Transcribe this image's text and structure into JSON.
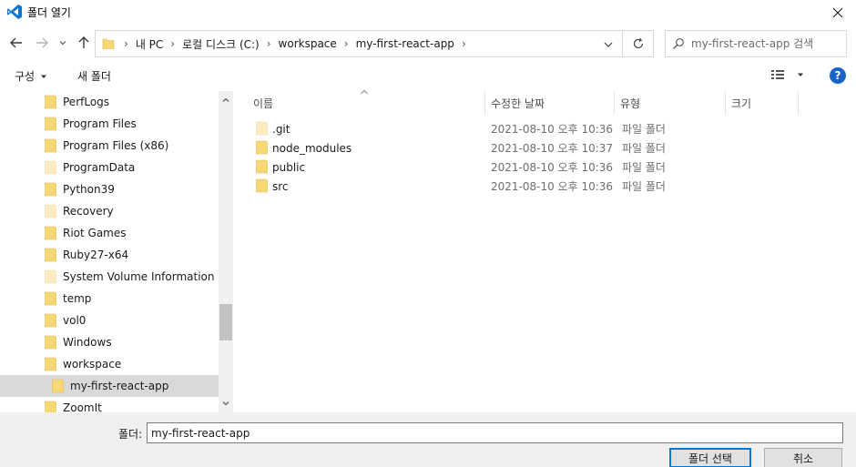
{
  "window": {
    "title": "폴더 열기",
    "icon": "vscode-icon",
    "accent": "#0078d7"
  },
  "address": {
    "breadcrumbs": [
      "내 PC",
      "로컬 디스크 (C:)",
      "workspace",
      "my-first-react-app"
    ],
    "search_placeholder": "my-first-react-app 검색"
  },
  "toolbar": {
    "organize_label": "구성",
    "new_folder_label": "새 폴더",
    "help_label": "?"
  },
  "nav": {
    "items": [
      {
        "label": "PerfLogs",
        "faded": false,
        "selected": false
      },
      {
        "label": "Program Files",
        "faded": false,
        "selected": false
      },
      {
        "label": "Program Files (x86)",
        "faded": false,
        "selected": false
      },
      {
        "label": "ProgramData",
        "faded": true,
        "selected": false
      },
      {
        "label": "Python39",
        "faded": false,
        "selected": false
      },
      {
        "label": "Recovery",
        "faded": true,
        "selected": false
      },
      {
        "label": "Riot Games",
        "faded": false,
        "selected": false
      },
      {
        "label": "Ruby27-x64",
        "faded": false,
        "selected": false
      },
      {
        "label": "System Volume Information",
        "faded": true,
        "selected": false
      },
      {
        "label": "temp",
        "faded": false,
        "selected": false
      },
      {
        "label": "vol0",
        "faded": false,
        "selected": false
      },
      {
        "label": "Windows",
        "faded": false,
        "selected": false
      },
      {
        "label": "workspace",
        "faded": false,
        "selected": false
      },
      {
        "label": "my-first-react-app",
        "faded": false,
        "selected": true
      },
      {
        "label": "ZoomIt",
        "faded": false,
        "selected": false
      }
    ]
  },
  "files": {
    "columns": [
      "이름",
      "수정한 날짜",
      "유형",
      "크기"
    ],
    "rows": [
      {
        "name": ".git",
        "date": "2021-08-10 오후 10:36",
        "type": "파일 폴더",
        "faded": true
      },
      {
        "name": "node_modules",
        "date": "2021-08-10 오후 10:37",
        "type": "파일 폴더",
        "faded": false
      },
      {
        "name": "public",
        "date": "2021-08-10 오후 10:36",
        "type": "파일 폴더",
        "faded": false
      },
      {
        "name": "src",
        "date": "2021-08-10 오후 10:36",
        "type": "파일 폴더",
        "faded": false
      }
    ]
  },
  "bottom": {
    "folder_label": "폴더:",
    "folder_value": "my-first-react-app",
    "select_label": "폴더 선택",
    "cancel_label": "취소"
  },
  "colors": {
    "folder": "#f8d775",
    "folder_faded": "#fcecc0",
    "selected_bg": "#d9d9d9",
    "help": "#1a63c9"
  }
}
